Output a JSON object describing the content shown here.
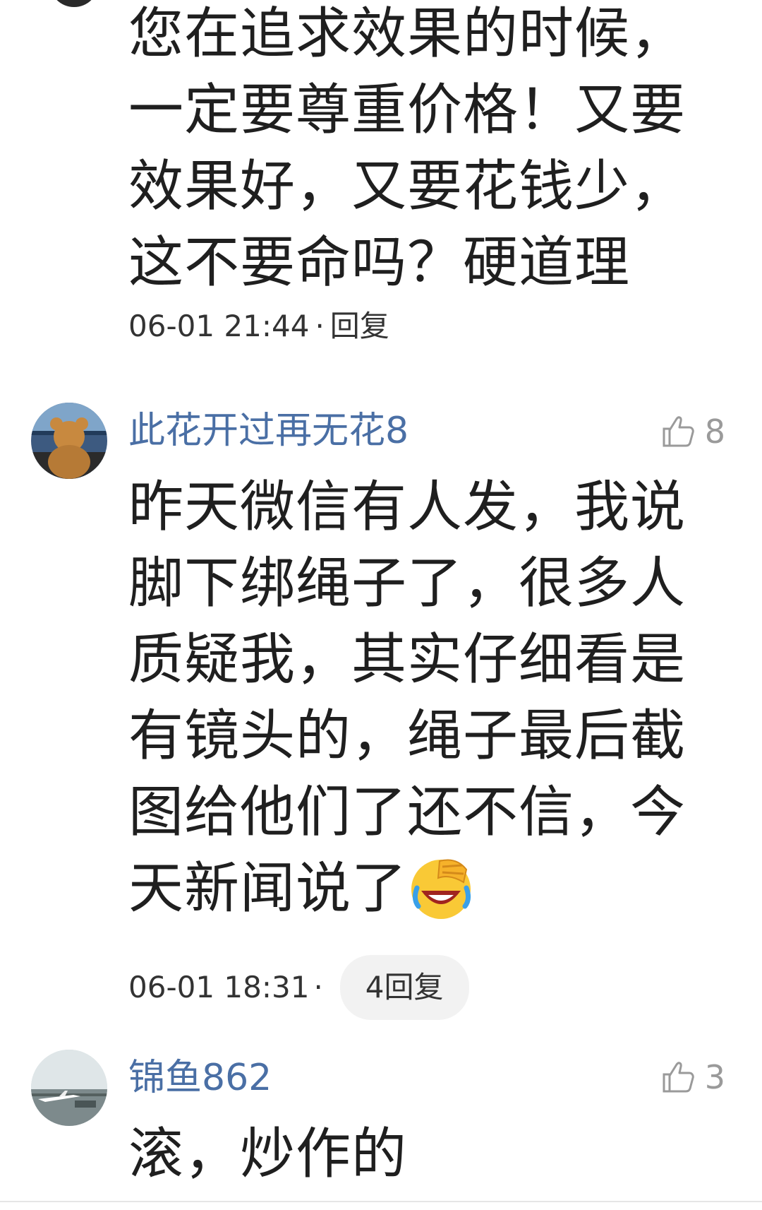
{
  "comments": [
    {
      "text": "您在追求效果的时候，一定要尊重价格！又要效果好，又要花钱少，这不要命吗？硬道理",
      "time": "06-01 21:44",
      "separator": "·",
      "reply_label": "回复"
    },
    {
      "username": "此花开过再无花8",
      "likes": "8",
      "text": "昨天微信有人发，我说脚下绑绳子了，很多人质疑我，其实仔细看是有镜头的，绳子最后截图给他们了还不信，今天新闻说了",
      "time": "06-01 18:31",
      "separator": "·",
      "reply_count_label": "4回复",
      "emoji": "facepalm-laughing-emoji"
    },
    {
      "username": "锦鱼862",
      "likes": "3",
      "text": "滚，炒作的"
    }
  ],
  "colors": {
    "username": "#4a6fa5",
    "like": "#9a9a9a",
    "text": "#1f1f1f",
    "pill_bg": "#f2f2f2"
  }
}
